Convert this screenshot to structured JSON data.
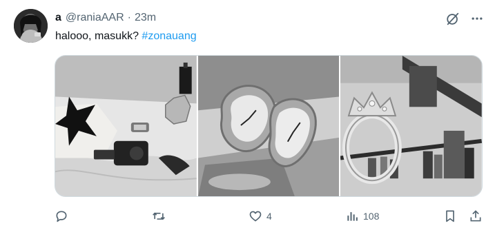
{
  "tweet": {
    "author": {
      "name": "a",
      "handle": "@raniaAAR",
      "time": "23m"
    },
    "separator": "·",
    "text": "halooo, masukk?",
    "hashtag": "#zonauang"
  },
  "actions": {
    "reply": {
      "icon": "reply-icon",
      "count": ""
    },
    "retweet": {
      "icon": "retweet-icon",
      "count": ""
    },
    "like": {
      "icon": "heart-icon",
      "count": "4"
    },
    "views": {
      "icon": "views-icon",
      "count": "108"
    },
    "bookmark": {
      "icon": "bookmark-icon"
    },
    "share": {
      "icon": "share-icon"
    }
  },
  "colors": {
    "accent": "#1d9bf0",
    "muted": "#536471",
    "text": "#0f1419",
    "border": "#cfd9de"
  }
}
